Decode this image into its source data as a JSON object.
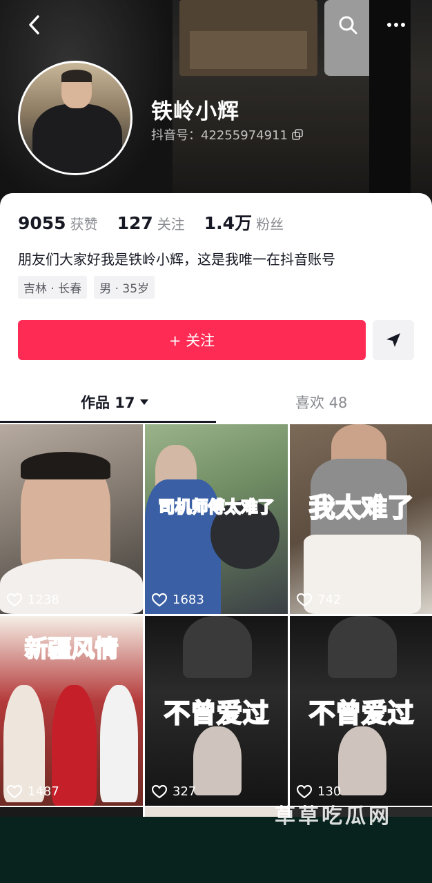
{
  "header": {
    "name": "铁岭小辉",
    "douyin_id": "抖音号：42255974911"
  },
  "stats": [
    {
      "value": "9055",
      "label": "获赞"
    },
    {
      "value": "127",
      "label": "关注"
    },
    {
      "value": "1.4万",
      "label": "粉丝"
    }
  ],
  "bio": "朋友们大家好我是铁岭小辉，这是我唯一在抖音账号",
  "tags": [
    "吉林 · 长春",
    "男 · 35岁"
  ],
  "follow_label": "+ 关注",
  "tabs": {
    "works": "作品 17",
    "likes": "喜欢 48"
  },
  "videos": [
    {
      "likes": "1238",
      "caption": ""
    },
    {
      "likes": "1683",
      "caption": "司机师傅太难了"
    },
    {
      "likes": "742",
      "caption": "我太难了"
    },
    {
      "likes": "1487",
      "caption": "新疆风情"
    },
    {
      "likes": "327",
      "caption": "不曾爱过"
    },
    {
      "likes": "130",
      "caption": "不曾爱过"
    }
  ],
  "watermark": "草草吃瓜网",
  "colors": {
    "accent": "#fe2c55",
    "text_primary": "#161823",
    "text_secondary": "#8a8b91",
    "caption_red": "#ff2b2b"
  }
}
